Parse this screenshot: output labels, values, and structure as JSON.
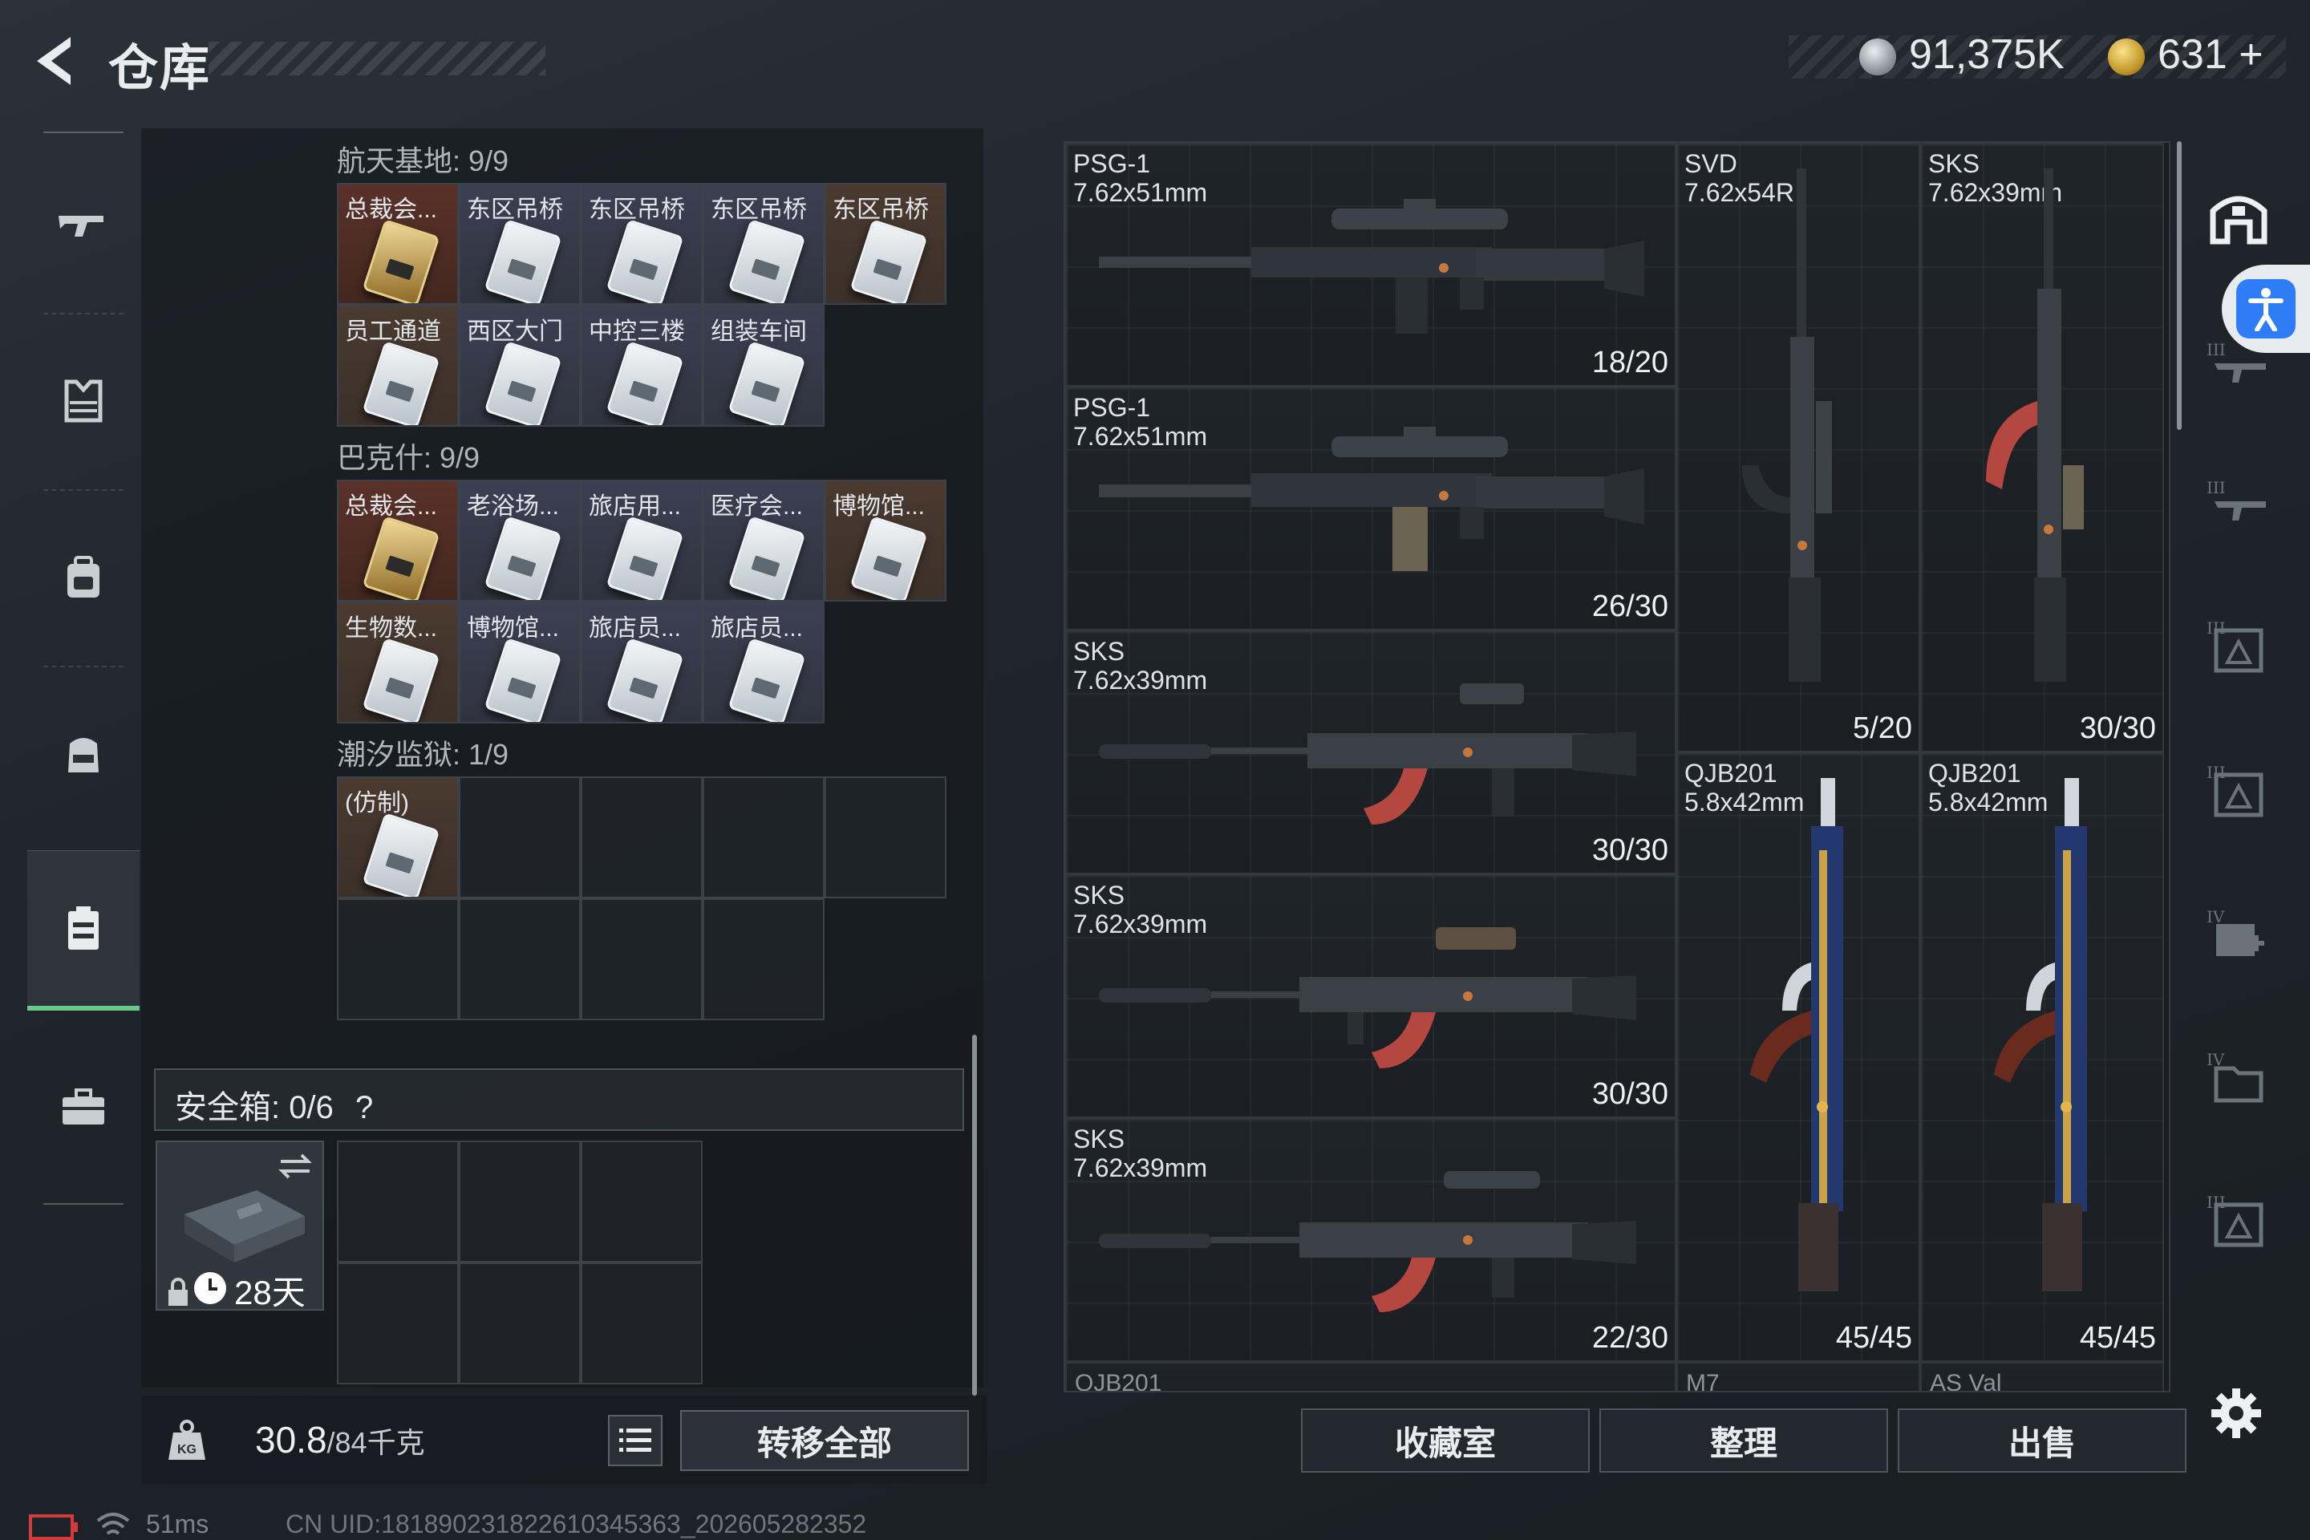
{
  "header": {
    "title": "仓库",
    "silver_value": "91,375K",
    "gold_value": "631",
    "gold_plus": "+"
  },
  "nav": {
    "items": [
      {
        "icon": "rifle-icon"
      },
      {
        "icon": "armor-vest-icon"
      },
      {
        "icon": "backpack-icon"
      },
      {
        "icon": "chest-rig-icon"
      },
      {
        "icon": "storage-case-icon",
        "active": true
      },
      {
        "icon": "briefcase-icon"
      }
    ]
  },
  "stash": {
    "sections": [
      {
        "title": "航天基地: 9/9",
        "cells": [
          {
            "label": "总裁会...",
            "kind": "gold"
          },
          {
            "label": "东区吊桥",
            "kind": "white"
          },
          {
            "label": "东区吊桥",
            "kind": "white"
          },
          {
            "label": "东区吊桥",
            "kind": "white"
          },
          {
            "label": "东区吊桥",
            "kind": "white"
          },
          {
            "label": "员工通道",
            "kind": "white"
          },
          {
            "label": "西区大门",
            "kind": "white"
          },
          {
            "label": "中控三楼",
            "kind": "white"
          },
          {
            "label": "组装车间",
            "kind": "white"
          }
        ]
      },
      {
        "title": "巴克什: 9/9",
        "cells": [
          {
            "label": "总裁会...",
            "kind": "gold"
          },
          {
            "label": "老浴场...",
            "kind": "white"
          },
          {
            "label": "旅店用...",
            "kind": "white"
          },
          {
            "label": "医疗会...",
            "kind": "white"
          },
          {
            "label": "博物馆...",
            "kind": "white"
          },
          {
            "label": "生物数...",
            "kind": "white"
          },
          {
            "label": "博物馆...",
            "kind": "white"
          },
          {
            "label": "旅店员...",
            "kind": "white"
          },
          {
            "label": "旅店员...",
            "kind": "white"
          }
        ]
      },
      {
        "title": "潮汐监狱: 1/9",
        "cells": [
          {
            "label": "(仿制)",
            "kind": "white"
          }
        ]
      }
    ],
    "safebox_label": "安全箱: 0/6",
    "safebox_help": "?",
    "safebox_days": "28天",
    "weight_value": "30.8",
    "weight_cap": "/84千克",
    "transfer_all": "转移全部"
  },
  "status": {
    "ping": "51ms",
    "uid": "CN UID:1818902318226103453​63_202605282352"
  },
  "weapons": [
    {
      "name": "PSG-1",
      "caliber": "7.62x51mm",
      "ammo": "18/20"
    },
    {
      "name": "PSG-1",
      "caliber": "7.62x51mm",
      "ammo": "26/30"
    },
    {
      "name": "SKS",
      "caliber": "7.62x39mm",
      "ammo": "30/30"
    },
    {
      "name": "SKS",
      "caliber": "7.62x39mm",
      "ammo": "30/30"
    },
    {
      "name": "SKS",
      "caliber": "7.62x39mm",
      "ammo": "22/30"
    },
    {
      "name": "SVD",
      "caliber": "7.62x54R",
      "ammo": "5/20"
    },
    {
      "name": "SKS",
      "caliber": "7.62x39mm",
      "ammo": "30/30"
    },
    {
      "name": "QJB201",
      "caliber": "5.8x42mm",
      "ammo": "45/45"
    },
    {
      "name": "QJB201",
      "caliber": "5.8x42mm",
      "ammo": "45/45"
    }
  ],
  "weapons_partial": [
    "QJB201",
    "M7",
    "AS Val"
  ],
  "actions": {
    "collection": "收藏室",
    "organize": "整理",
    "sell": "出售"
  },
  "right_icons": [
    "shelter-icon",
    "accessibility-icon",
    "tier-iii-rifle-icon",
    "tier-iii-rifle-icon",
    "tier-iii-armor-icon",
    "tier-iii-armor-icon",
    "tier-iv-medkit-icon",
    "tier-iv-folder-icon",
    "tier-iii-armor-icon"
  ],
  "colors": {
    "accent_green": "#69c98a",
    "accessibility_blue": "#2f7df6"
  }
}
